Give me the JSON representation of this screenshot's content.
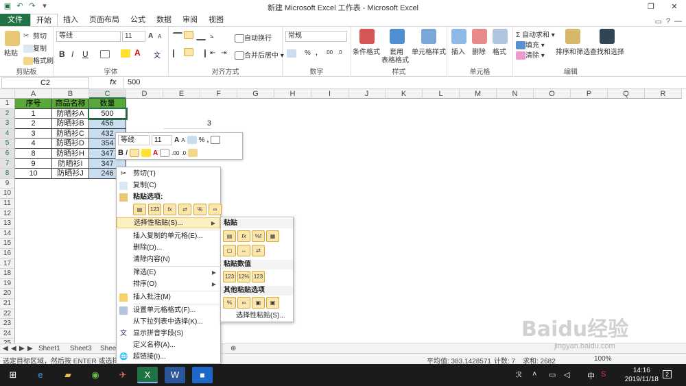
{
  "window": {
    "title": "新建 Microsoft Excel 工作表 - Microsoft Excel",
    "controls": [
      "?",
      "—",
      "❐",
      "✕"
    ]
  },
  "tabs": [
    "文件",
    "开始",
    "插入",
    "页面布局",
    "公式",
    "数据",
    "审阅",
    "视图"
  ],
  "active_tab": "开始",
  "ribbon": {
    "clipboard": {
      "label": "剪贴板",
      "paste": "粘贴",
      "cut": "剪切",
      "copy": "复制",
      "format_painter": "格式刷"
    },
    "font": {
      "label": "字体",
      "font_name": "等线",
      "font_size": "11",
      "bold": "B",
      "italic": "I",
      "underline": "U"
    },
    "alignment": {
      "label": "对齐方式",
      "wrap": "自动换行",
      "merge": "合并后居中"
    },
    "number": {
      "label": "数字",
      "format": "常规",
      "percent": "%",
      "comma": ","
    },
    "styles": {
      "label": "样式",
      "conditional": "条件格式",
      "table": "套用",
      "table2": "表格格式",
      "cell_styles": "单元格样式"
    },
    "cells": {
      "label": "单元格",
      "insert": "插入",
      "delete": "删除",
      "format": "格式"
    },
    "editing": {
      "label": "编辑",
      "autosum": "自动求和",
      "fill": "填充",
      "clear": "清除",
      "sort": "排序和筛选",
      "find": "查找和选择"
    }
  },
  "formula_bar": {
    "name_box": "C2",
    "fx": "fx",
    "value": "500"
  },
  "columns": [
    "A",
    "B",
    "C",
    "D",
    "E",
    "F",
    "G",
    "H",
    "I",
    "J",
    "K",
    "L",
    "M",
    "N",
    "O",
    "P",
    "Q",
    "R"
  ],
  "rows": [
    "1",
    "2",
    "3",
    "4",
    "5",
    "6",
    "7",
    "8",
    "9",
    "10",
    "11",
    "12",
    "13",
    "14",
    "15",
    "16",
    "17",
    "18",
    "19",
    "20",
    "21",
    "22",
    "23",
    "24",
    "25"
  ],
  "table": {
    "headers": [
      "序号",
      "商品名称",
      "数量"
    ],
    "rows": [
      [
        "1",
        "防晒衫A",
        "500"
      ],
      [
        "2",
        "防晒衫B",
        "456"
      ],
      [
        "3",
        "防晒衫C",
        "432"
      ],
      [
        "4",
        "防晒衫D",
        "354"
      ],
      [
        "8",
        "防晒衫H",
        "347"
      ],
      [
        "9",
        "防晒衫I",
        "347"
      ],
      [
        "10",
        "防晒衫J",
        "246"
      ]
    ],
    "extra_value": "3"
  },
  "mini_toolbar": {
    "font": "等线",
    "size": "11",
    "percent": "%",
    "comma": ","
  },
  "context_menu": {
    "cut": "剪切(T)",
    "copy": "复制(C)",
    "paste_options": "粘贴选项:",
    "paste_special": "选择性粘贴(S)...",
    "insert_copied": "插入复制的单元格(E)...",
    "delete": "删除(D)...",
    "clear": "清除内容(N)",
    "filter": "筛选(E)",
    "sort": "排序(O)",
    "insert_comment": "插入批注(M)",
    "format_cells": "设置单元格格式(F)...",
    "pick_list": "从下拉列表中选择(K)...",
    "phonetic": "显示拼音字段(S)",
    "define_name": "定义名称(A)...",
    "hyperlink": "超链接(I)..."
  },
  "submenu": {
    "paste": "粘贴",
    "paste_values": "粘贴数值",
    "other": "其他粘贴选项",
    "paste_special": "选择性粘贴(S)..."
  },
  "sheets": [
    "Sheet1",
    "Sheet3",
    "Shee"
  ],
  "status": {
    "message": "选定目标区域，然后按 ENTER 或选择",
    "average": "平均值: 383.1428571",
    "count": "计数: 7",
    "sum": "求和: 2682",
    "zoom": "100%"
  },
  "taskbar": {
    "time": "14:16",
    "date": "2019/11/18",
    "ime": "中",
    "notifications": "2"
  },
  "watermark": {
    "brand": "Baidu经验",
    "url": "jingyan.baidu.com"
  },
  "colors": {
    "excel_green": "#217346",
    "header_fill": "#5aa83c",
    "menu_highlight": "#fcf0c3"
  }
}
